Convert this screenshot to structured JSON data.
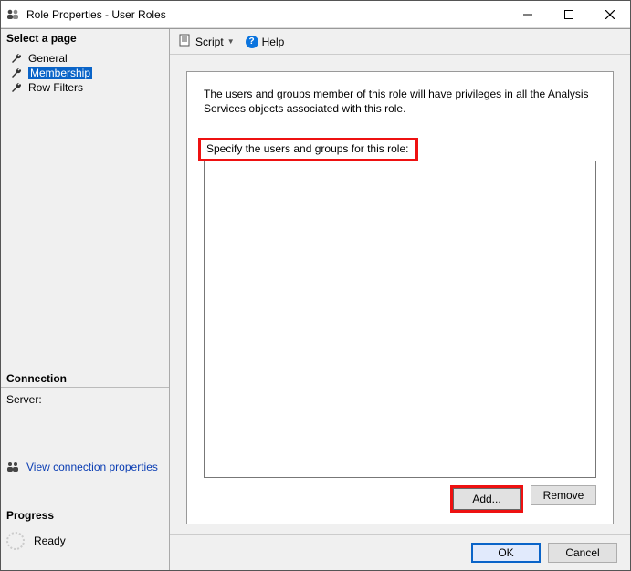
{
  "window": {
    "title": "Role Properties - User Roles"
  },
  "sidebar": {
    "select_page_header": "Select a page",
    "pages": [
      {
        "label": "General"
      },
      {
        "label": "Membership"
      },
      {
        "label": "Row Filters"
      }
    ],
    "connection_header": "Connection",
    "server_label": "Server:",
    "view_connection_link": "View connection properties",
    "progress_header": "Progress",
    "progress_status": "Ready"
  },
  "toolbar": {
    "script_label": "Script",
    "help_label": "Help"
  },
  "main": {
    "description": "The users and groups member of this role will have privileges in all the Analysis Services objects associated with this role.",
    "specify_label": "Specify the users and groups for this role:",
    "add_button": "Add...",
    "remove_button": "Remove"
  },
  "footer": {
    "ok": "OK",
    "cancel": "Cancel"
  }
}
